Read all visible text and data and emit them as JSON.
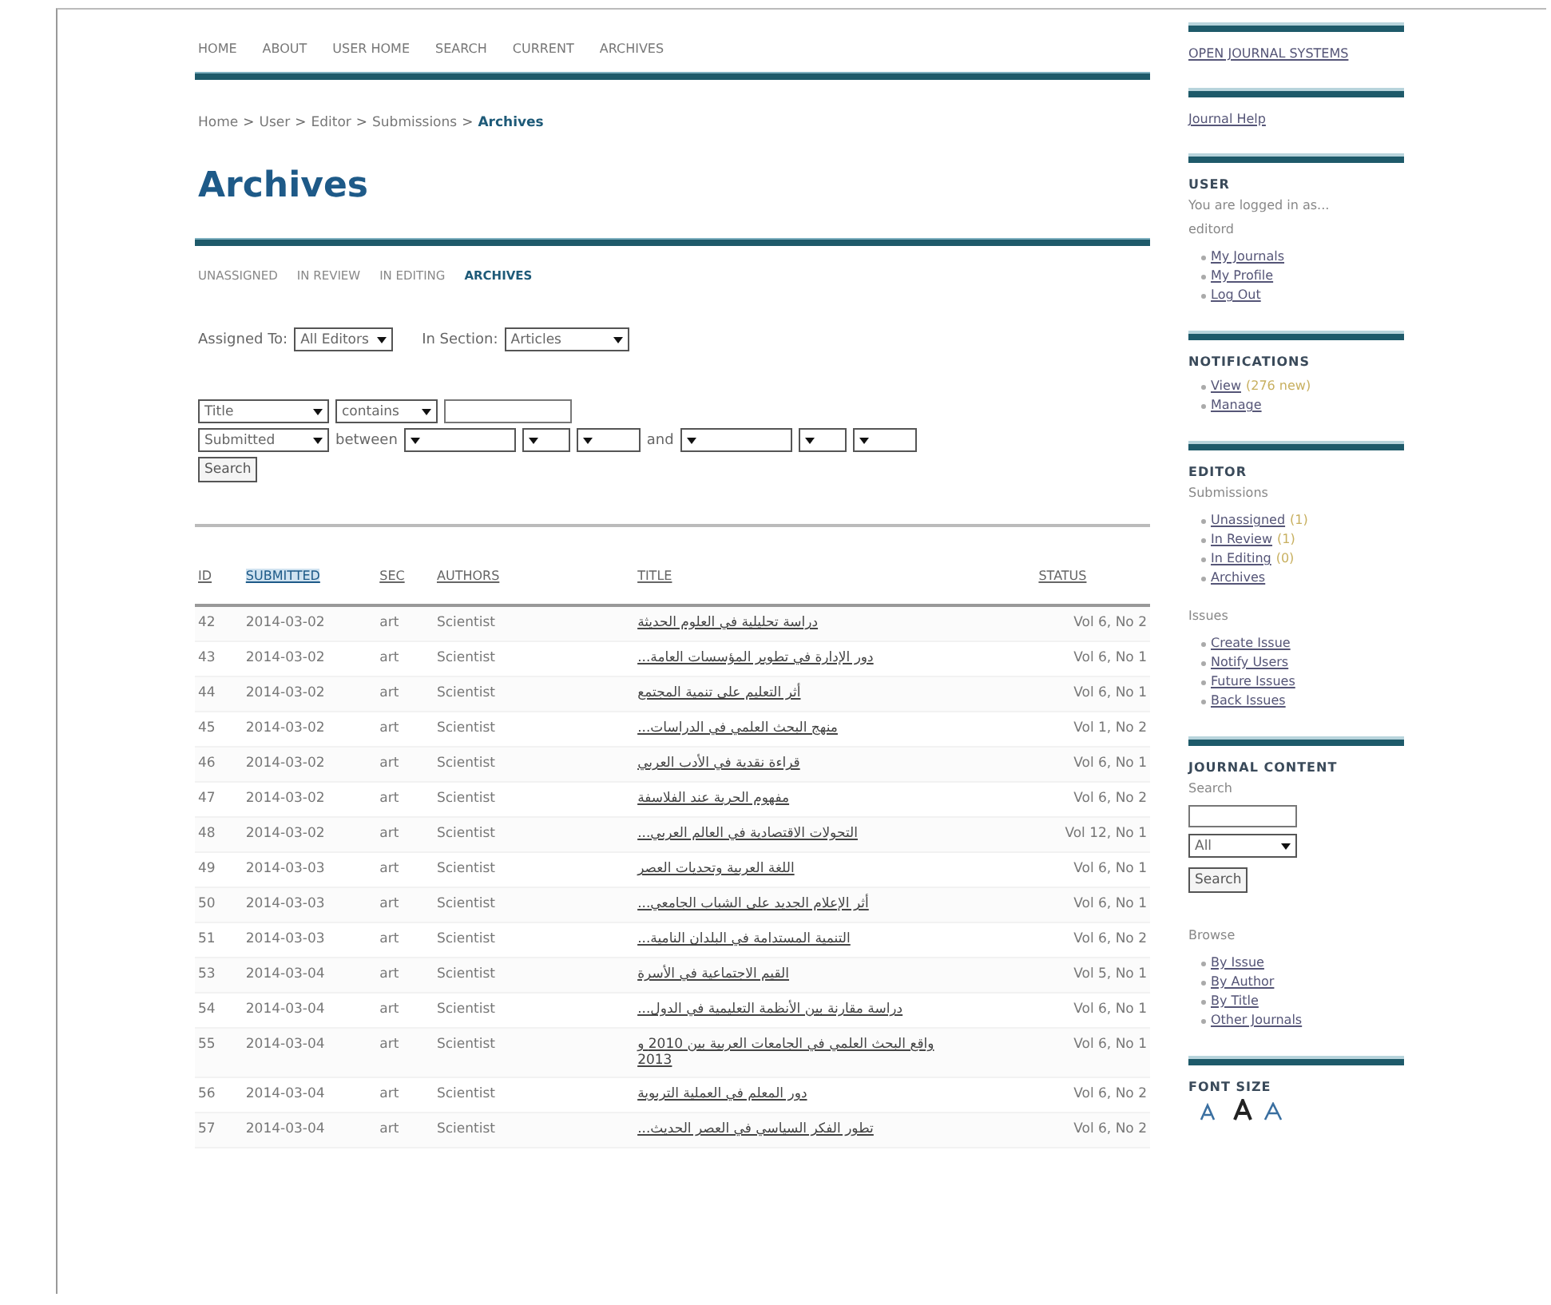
{
  "nav": [
    "HOME",
    "ABOUT",
    "USER HOME",
    "SEARCH",
    "CURRENT",
    "ARCHIVES"
  ],
  "breadcrumb": [
    {
      "label": "Home",
      "current": false
    },
    {
      "label": "User",
      "current": false
    },
    {
      "label": "Editor",
      "current": false
    },
    {
      "label": "Submissions",
      "current": false
    },
    {
      "label": "Archives",
      "current": true
    }
  ],
  "breadcrumb_separator": ">",
  "page_title": "Archives",
  "tabs": [
    {
      "label": "UNASSIGNED",
      "selected": false
    },
    {
      "label": "IN REVIEW",
      "selected": false
    },
    {
      "label": "IN EDITING",
      "selected": false
    },
    {
      "label": "ARCHIVES",
      "selected": true
    }
  ],
  "filters": {
    "assigned_label": "Assigned To:",
    "assigned_value": "All Editors",
    "section_label": "In Section:",
    "section_value": "Articles"
  },
  "search": {
    "field": "Title",
    "match": "contains",
    "date_field": "Submitted",
    "between": "between",
    "and": "and",
    "button": "Search"
  },
  "table": {
    "columns": [
      {
        "label": "ID",
        "sorted": false
      },
      {
        "label": "SUBMITTED",
        "sorted": true
      },
      {
        "label": "SEC",
        "sorted": false
      },
      {
        "label": "AUTHORS",
        "sorted": false
      },
      {
        "label": "TITLE",
        "sorted": false
      },
      {
        "label": "STATUS",
        "sorted": false
      }
    ],
    "rows": [
      {
        "id": "42",
        "submitted": "2014-03-02",
        "sec": "art",
        "authors": "Scientist",
        "title": "دراسة تحليلية في العلوم الحديثة",
        "status": "Vol 6, No 2"
      },
      {
        "id": "43",
        "submitted": "2014-03-02",
        "sec": "art",
        "authors": "Scientist",
        "title": "دور الإدارة في تطوير المؤسسات العامة...",
        "status": "Vol 6, No 1"
      },
      {
        "id": "44",
        "submitted": "2014-03-02",
        "sec": "art",
        "authors": "Scientist",
        "title": "أثر التعليم على تنمية المجتمع",
        "status": "Vol 6, No 1"
      },
      {
        "id": "45",
        "submitted": "2014-03-02",
        "sec": "art",
        "authors": "Scientist",
        "title": "منهج البحث العلمي في الدراسات...",
        "status": "Vol 1, No 2"
      },
      {
        "id": "46",
        "submitted": "2014-03-02",
        "sec": "art",
        "authors": "Scientist",
        "title": "قراءة نقدية في الأدب العربي",
        "status": "Vol 6, No 1"
      },
      {
        "id": "47",
        "submitted": "2014-03-02",
        "sec": "art",
        "authors": "Scientist",
        "title": "مفهوم الحرية عند الفلاسفة",
        "status": "Vol 6, No 2"
      },
      {
        "id": "48",
        "submitted": "2014-03-02",
        "sec": "art",
        "authors": "Scientist",
        "title": "التحولات الاقتصادية في العالم العربي...",
        "status": "Vol 12, No 1"
      },
      {
        "id": "49",
        "submitted": "2014-03-03",
        "sec": "art",
        "authors": "Scientist",
        "title": "اللغة العربية وتحديات العصر",
        "status": "Vol 6, No 1"
      },
      {
        "id": "50",
        "submitted": "2014-03-03",
        "sec": "art",
        "authors": "Scientist",
        "title": "أثر الإعلام الجديد على الشباب الجامعي...",
        "status": "Vol 6, No 1"
      },
      {
        "id": "51",
        "submitted": "2014-03-03",
        "sec": "art",
        "authors": "Scientist",
        "title": "التنمية المستدامة في البلدان النامية...",
        "status": "Vol 6, No 2"
      },
      {
        "id": "53",
        "submitted": "2014-03-04",
        "sec": "art",
        "authors": "Scientist",
        "title": "القيم الاجتماعية في الأسرة",
        "status": "Vol 5, No 1"
      },
      {
        "id": "54",
        "submitted": "2014-03-04",
        "sec": "art",
        "authors": "Scientist",
        "title": "دراسة مقارنة بين الأنظمة التعليمية في الدول...",
        "status": "Vol 6, No 1"
      },
      {
        "id": "55",
        "submitted": "2014-03-04",
        "sec": "art",
        "authors": "Scientist",
        "title": "واقع البحث العلمي في الجامعات العربية بين 2010 و 2013",
        "status": "Vol 6, No 1"
      },
      {
        "id": "56",
        "submitted": "2014-03-04",
        "sec": "art",
        "authors": "Scientist",
        "title": "دور المعلم في العملية التربوية",
        "status": "Vol 6, No 2"
      },
      {
        "id": "57",
        "submitted": "2014-03-04",
        "sec": "art",
        "authors": "Scientist",
        "title": "تطور الفكر السياسي في العصر الحديث...",
        "status": "Vol 6, No 2"
      }
    ]
  },
  "sidebar": [
    {
      "items": [
        {
          "kind": "link",
          "label": "OPEN JOURNAL SYSTEMS"
        }
      ]
    },
    {
      "items": [
        {
          "kind": "link",
          "label": "Journal Help"
        }
      ]
    },
    {
      "title": "USER",
      "items": [
        {
          "kind": "note",
          "label": "You are logged in as..."
        },
        {
          "kind": "note",
          "label": "editord"
        },
        {
          "kind": "list",
          "links": [
            {
              "label": "My Journals"
            },
            {
              "label": "My Profile"
            },
            {
              "label": "Log Out"
            }
          ]
        }
      ]
    },
    {
      "title": "NOTIFICATIONS",
      "items": [
        {
          "kind": "list",
          "links": [
            {
              "label": "View",
              "extra": "(276 new)"
            },
            {
              "label": "Manage"
            }
          ]
        }
      ]
    },
    {
      "title": "EDITOR",
      "items": [
        {
          "kind": "note",
          "label": "Submissions"
        },
        {
          "kind": "list",
          "links": [
            {
              "label": "Unassigned",
              "extra": "(1)"
            },
            {
              "label": "In Review",
              "extra": "(1)"
            },
            {
              "label": "In Editing",
              "extra": "(0)"
            },
            {
              "label": "Archives"
            }
          ]
        },
        {
          "kind": "note",
          "label": "Issues"
        },
        {
          "kind": "list",
          "links": [
            {
              "label": "Create Issue"
            },
            {
              "label": "Notify Users"
            },
            {
              "label": "Future Issues"
            },
            {
              "label": "Back Issues"
            }
          ]
        }
      ]
    },
    {
      "title": "JOURNAL CONTENT",
      "items": [
        {
          "kind": "note",
          "label": "Search"
        },
        {
          "kind": "field"
        },
        {
          "kind": "dropdown",
          "label": "All"
        },
        {
          "kind": "button",
          "label": "Search"
        },
        {
          "kind": "note",
          "label": "Browse"
        },
        {
          "kind": "list",
          "links": [
            {
              "label": "By Issue"
            },
            {
              "label": "By Author"
            },
            {
              "label": "By Title"
            },
            {
              "label": "Other Journals"
            }
          ]
        }
      ]
    },
    {
      "title": "FONT SIZE",
      "items": [
        {
          "kind": "fontsize"
        }
      ]
    }
  ]
}
